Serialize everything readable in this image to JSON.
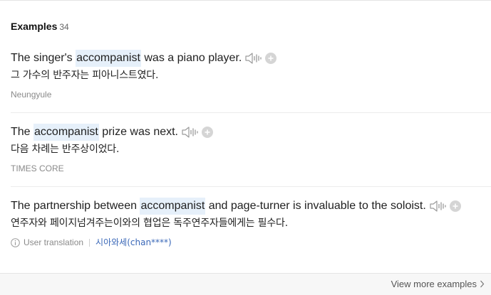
{
  "header": {
    "title": "Examples",
    "count": "34"
  },
  "examples": [
    {
      "before": "The singer's ",
      "keyword": "accompanist",
      "after": " was a piano player.",
      "translation": "그 가수의 반주자는 피아니스트였다.",
      "source": "Neungyule"
    },
    {
      "before": "The ",
      "keyword": "accompanist",
      "after": " prize was next.",
      "translation": "다음 차례는 반주상이었다.",
      "source": "TIMES CORE"
    },
    {
      "before": "The partnership between ",
      "keyword": "accompanist",
      "after": " and page-turner is invaluable to the soloist.",
      "translation": "연주자와 페이지넘겨주는이와의 협업은 독주연주자들에게는 필수다.",
      "source_label": "User translation",
      "user": "시아와세(chan****)"
    }
  ],
  "footer": {
    "view_more": "View more examples"
  },
  "icons": {
    "speaker": "speaker-icon",
    "add": "plus-circle-icon",
    "info": "info-circle-icon",
    "chevron": "chevron-right-icon"
  },
  "colors": {
    "highlight": "#e6f0fa",
    "icon_gray": "#bdbdbd",
    "user_link": "#3a68b8"
  }
}
